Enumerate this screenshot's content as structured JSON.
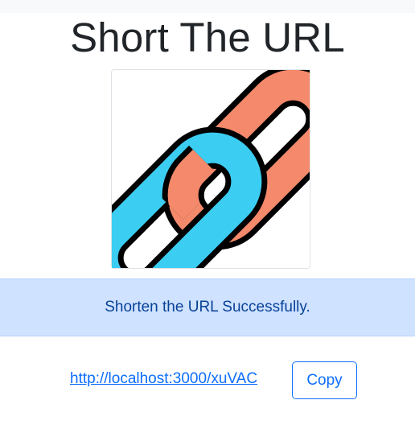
{
  "page": {
    "title": "Short The URL"
  },
  "logo": {
    "icon": "chain-link-icon",
    "colors": {
      "link_blue": "#3ccdf2",
      "link_orange": "#f48a6b",
      "outline": "#000000"
    }
  },
  "alert": {
    "message": "Shorten the URL Successfully.",
    "background": "#cfe2ff",
    "text_color": "#084298"
  },
  "result": {
    "short_url": "http://localhost:3000/xuVAC",
    "copy_label": "Copy",
    "accent": "#0d6efd"
  }
}
